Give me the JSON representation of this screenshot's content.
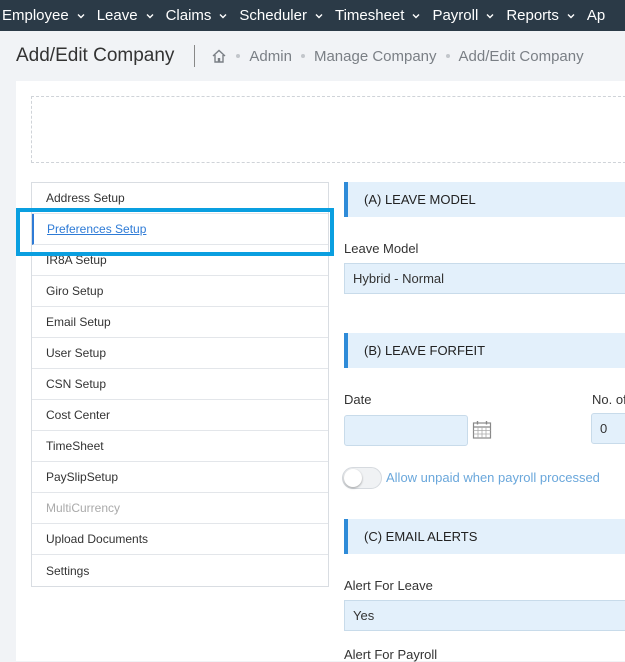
{
  "topnav": {
    "items": [
      "Employee",
      "Leave",
      "Claims",
      "Scheduler",
      "Timesheet",
      "Payroll",
      "Reports",
      "Ap"
    ]
  },
  "header": {
    "title": "Add/Edit Company",
    "breadcrumb": [
      "Admin",
      "Manage Company",
      "Add/Edit Company"
    ]
  },
  "menu": {
    "items": [
      {
        "label": "Address Setup"
      },
      {
        "label": "Preferences Setup"
      },
      {
        "label": "IR8A Setup"
      },
      {
        "label": "Giro Setup"
      },
      {
        "label": "Email Setup"
      },
      {
        "label": "User Setup"
      },
      {
        "label": "CSN Setup"
      },
      {
        "label": "Cost Center"
      },
      {
        "label": "TimeSheet"
      },
      {
        "label": "PaySlipSetup"
      },
      {
        "label": "MultiCurrency"
      },
      {
        "label": "Upload Documents"
      },
      {
        "label": "Settings"
      }
    ],
    "active": "Preferences Setup",
    "disabled": "MultiCurrency"
  },
  "leave_model": {
    "heading": "(A) LEAVE MODEL",
    "label": "Leave Model",
    "value": "Hybrid - Normal"
  },
  "leave_forfeit": {
    "heading": "(B) LEAVE FORFEIT",
    "date_label": "Date",
    "date_value": "",
    "no_label": "No. of",
    "no_value": "0",
    "toggle_label": "Allow unpaid when payroll processed",
    "toggle_on": false
  },
  "email_alerts": {
    "heading": "(C) EMAIL ALERTS",
    "alert_leave_label": "Alert For Leave",
    "alert_leave_value": "Yes",
    "alert_payroll_label": "Alert For Payroll"
  },
  "colors": {
    "nav_bg": "#2b3a47",
    "accent": "#2e8bd8",
    "highlight": "#0a9fe0",
    "field_bg": "#e3f0fb"
  }
}
